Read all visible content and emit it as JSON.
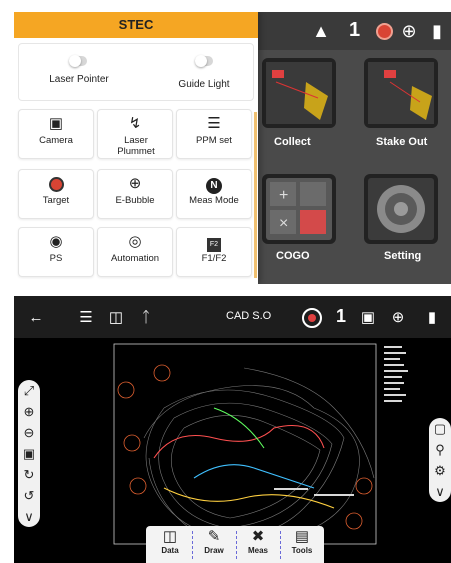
{
  "top_screen": {
    "status_bar": {
      "point_count": "1"
    },
    "stec_panel": {
      "title": "STEC",
      "toggles": [
        {
          "label": "Laser Pointer",
          "on": false
        },
        {
          "label": "Guide Light",
          "on": false
        }
      ],
      "grid": [
        {
          "label": "Camera",
          "icon": "camera-icon"
        },
        {
          "label": "Laser Plummet",
          "icon": "laser-plummet-icon"
        },
        {
          "label": "PPM set",
          "icon": "sliders-icon"
        },
        {
          "label": "Target",
          "icon": "target-icon"
        },
        {
          "label": "E-Bubble",
          "icon": "crosshair-icon"
        },
        {
          "label": "Meas Mode",
          "icon": "meas-mode-icon"
        },
        {
          "label": "PS",
          "icon": "binoculars-icon"
        },
        {
          "label": "Automation",
          "icon": "automation-icon"
        },
        {
          "label": "F1/F2",
          "icon": "face-switch-icon"
        }
      ]
    },
    "app_tiles": [
      {
        "label": "Collect"
      },
      {
        "label": "Stake Out"
      },
      {
        "label": "COGO"
      },
      {
        "label": "Setting"
      }
    ]
  },
  "bottom_screen": {
    "status_bar": {
      "title": "CAD S.O",
      "point_count": "1"
    },
    "bottom_toolbar": [
      {
        "label": "Data",
        "icon": "database-icon"
      },
      {
        "label": "Draw",
        "icon": "draw-icon"
      },
      {
        "label": "Meas",
        "icon": "measure-icon"
      },
      {
        "label": "Tools",
        "icon": "toolbox-icon"
      }
    ],
    "left_tools": [
      "zoom-extents-icon",
      "zoom-in-icon",
      "zoom-out-icon",
      "zoom-window-icon",
      "rotate-icon",
      "refresh-icon",
      "collapse-icon"
    ],
    "right_tools": [
      "select-icon",
      "location-icon",
      "settings-icon",
      "collapse-icon"
    ]
  },
  "colors": {
    "stec_header": "#f5a623",
    "target_red": "#d94434",
    "map_background": "#000000"
  }
}
